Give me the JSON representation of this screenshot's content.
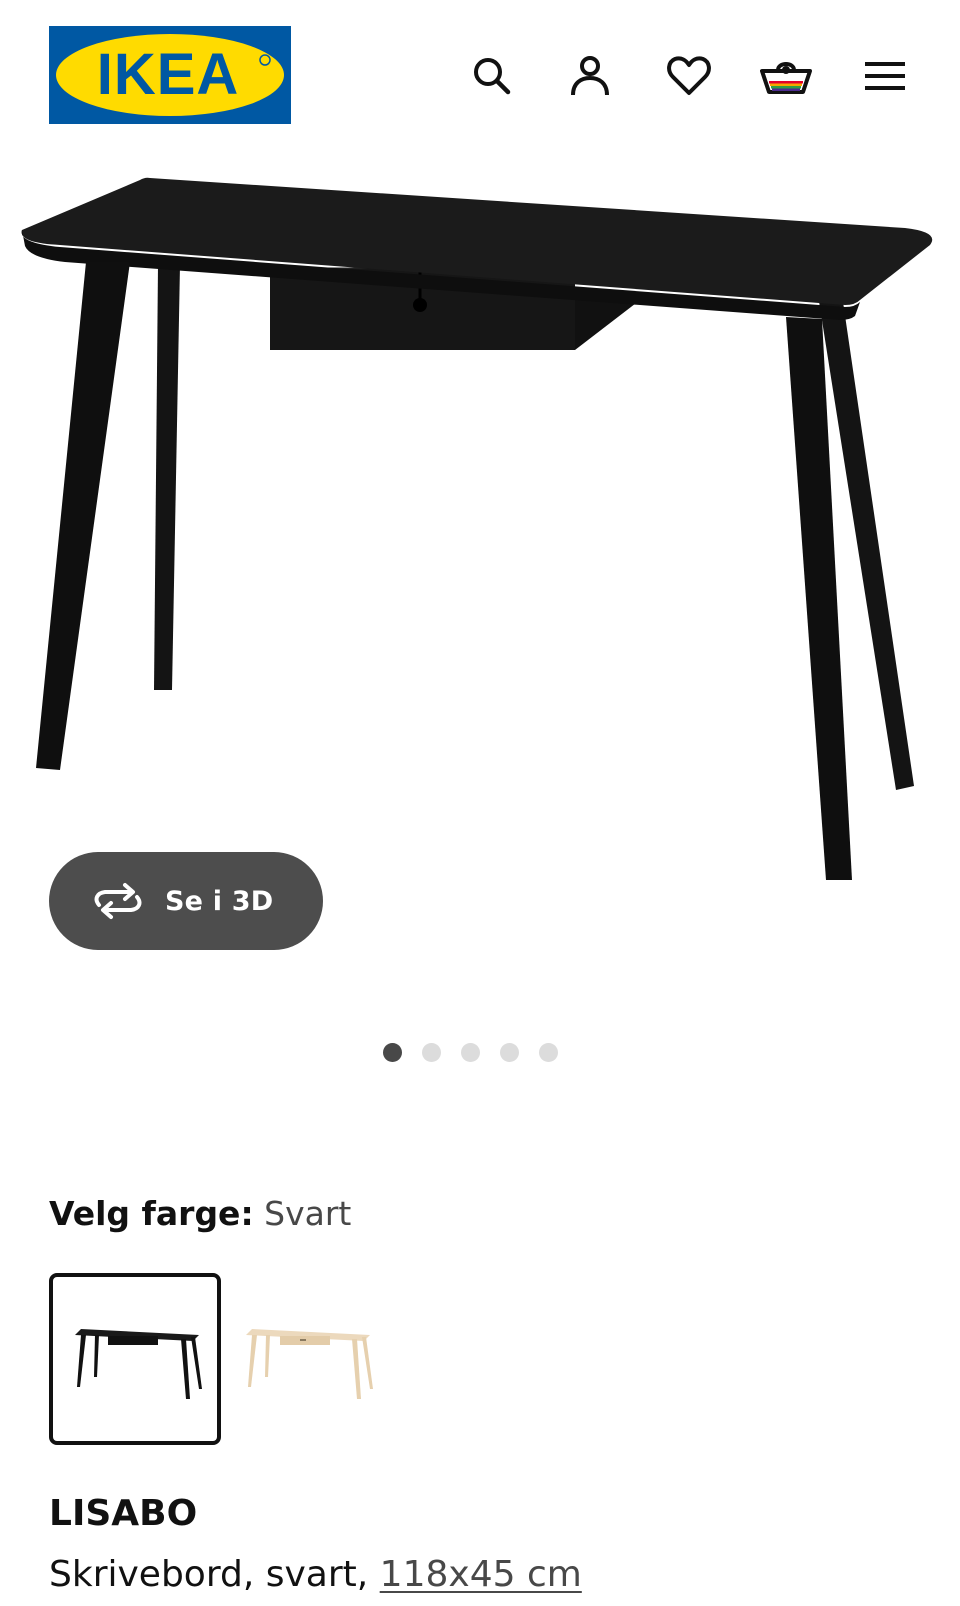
{
  "header": {
    "logo_text": "IKEA",
    "logo_colors": {
      "background": "#0058A3",
      "ellipse": "#FFDB00",
      "text": "#0058A3"
    },
    "icons": [
      "search-icon",
      "user-icon",
      "heart-icon",
      "basket-icon",
      "menu-icon"
    ]
  },
  "gallery": {
    "view_3d_label": "Se i 3D",
    "image_count": 5,
    "active_index": 0
  },
  "color_picker": {
    "label": "Velg farge:",
    "selected_value": "Svart",
    "options": [
      {
        "name": "black-desk",
        "color": "#1a1a1a",
        "selected": true
      },
      {
        "name": "birch-desk",
        "color": "#ecd9bd",
        "selected": false
      }
    ]
  },
  "product": {
    "name": "LISABO",
    "description_prefix": "Skrivebord, svart, ",
    "size_link": "118x45 cm"
  }
}
